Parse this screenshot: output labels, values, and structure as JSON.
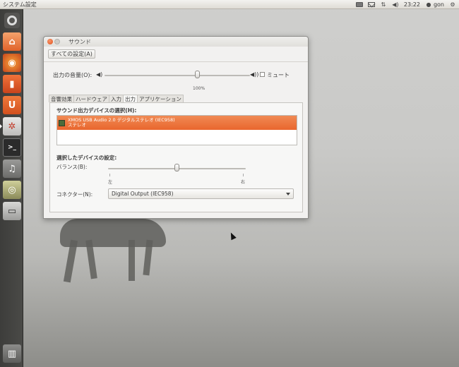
{
  "top_panel": {
    "app_title": "システム設定",
    "time": "23:22",
    "user": "gon"
  },
  "window": {
    "title": "サウンド",
    "all_settings_label": "すべての設定(A)",
    "volume": {
      "label": "出力の音量(O):",
      "value_label": "100%",
      "level_percent": 100,
      "mute_label": "ミュート",
      "muted": false
    },
    "tabs": [
      {
        "label": "音響効果",
        "selected": false
      },
      {
        "label": "ハードウェア",
        "selected": false
      },
      {
        "label": "入力",
        "selected": false
      },
      {
        "label": "出力",
        "selected": true
      },
      {
        "label": "アプリケーション",
        "selected": false
      }
    ],
    "output": {
      "device_section_title": "サウンド出力デバイスの選択(H):",
      "devices": [
        {
          "name": "XMOS USB Audio 2.0 デジタルステレオ (IEC958)",
          "sub": "ステレオ",
          "selected": true
        }
      ],
      "settings_title": "選択したデバイスの設定:",
      "balance_label": "バランス(B):",
      "balance_left": "左",
      "balance_right": "右",
      "balance_position": 0.5,
      "connector_label": "コネクター(N):",
      "connector_value": "Digital Output (IEC958)"
    }
  },
  "colors": {
    "accent": "#e9662d",
    "launcher": "#3d3d3b",
    "panel": "#dedbd5"
  }
}
